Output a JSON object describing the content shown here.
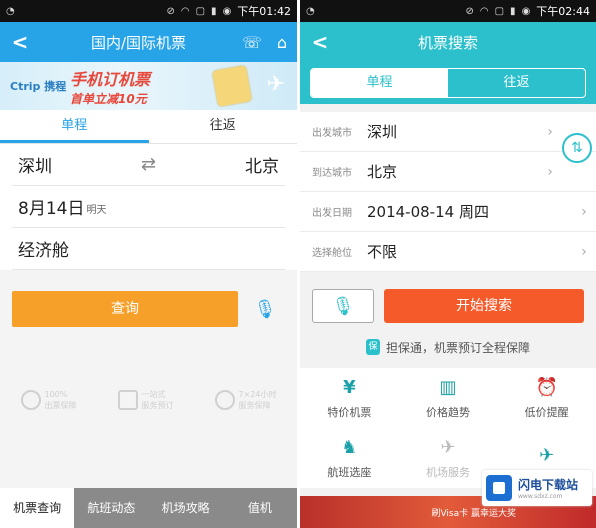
{
  "left": {
    "statusbar": {
      "time": "下午01:42"
    },
    "titlebar": {
      "title": "国内/国际机票",
      "back_icon": "chevron-left",
      "phone_icon": "phone",
      "home_icon": "home"
    },
    "banner": {
      "brand": "Ctrip 携程",
      "promo_line1": "手机订机票",
      "promo_line2": "首单立减10元"
    },
    "tabs": [
      "单程",
      "往返"
    ],
    "form": {
      "from": "深圳",
      "to": "北京",
      "date": "8月14日",
      "date_suffix": "明天",
      "cabin": "经济舱"
    },
    "query_label": "查询",
    "services": [
      {
        "line1": "100%",
        "line2": "出票保障"
      },
      {
        "line1": "一站式",
        "line2": "服务预订"
      },
      {
        "line1": "7×24小时",
        "line2": "服务保障"
      }
    ],
    "bottom_nav": [
      "机票查询",
      "航班动态",
      "机场攻略",
      "值机"
    ]
  },
  "right": {
    "statusbar": {
      "time": "下午02:44"
    },
    "titlebar": {
      "title": "机票搜索"
    },
    "segments": [
      "单程",
      "往返"
    ],
    "rows": [
      {
        "label": "出发城市",
        "value": "深圳"
      },
      {
        "label": "到达城市",
        "value": "北京"
      },
      {
        "label": "出发日期",
        "value": "2014-08-14  周四"
      },
      {
        "label": "选择舱位",
        "value": "不限"
      }
    ],
    "start_label": "开始搜索",
    "guarantee": "担保通，机票预订全程保障",
    "grid": [
      {
        "label": "特价机票",
        "icon": "¥"
      },
      {
        "label": "价格趋势",
        "icon": "▥"
      },
      {
        "label": "低价提醒",
        "icon": "⏰"
      },
      {
        "label": "航班选座",
        "icon": "♞"
      },
      {
        "label": "机场服务",
        "icon": "✈"
      },
      {
        "label": "",
        "icon": "✈"
      }
    ],
    "bottom_banner": "刷Visa卡 赢幸运大奖"
  },
  "watermark": {
    "title": "闪电下载站",
    "sub": "www.sdxz.com"
  }
}
